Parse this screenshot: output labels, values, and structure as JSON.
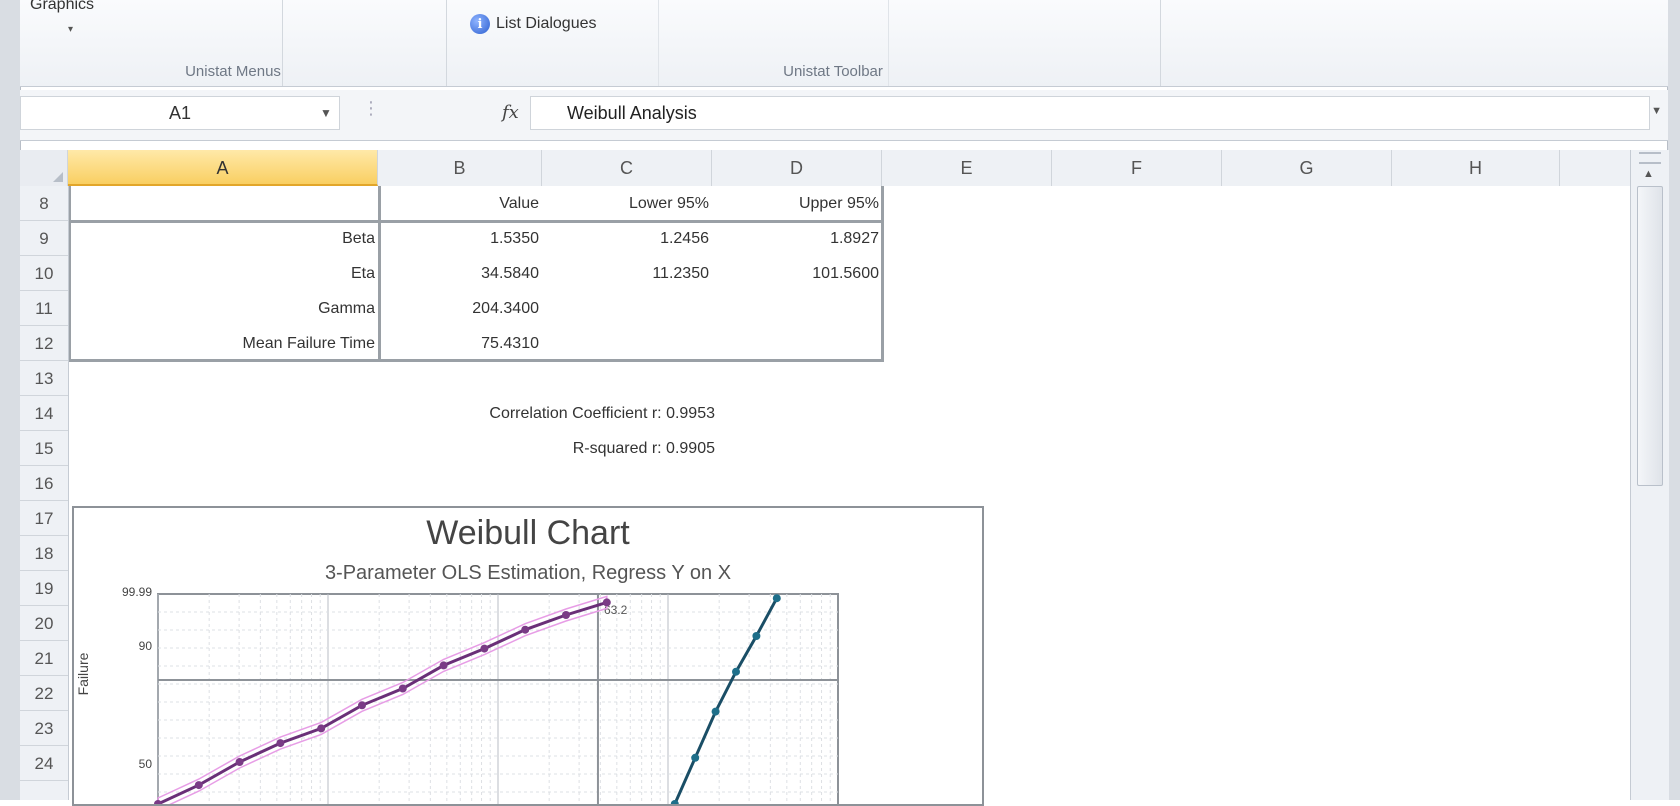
{
  "ribbon": {
    "graphics_label": "Graphics",
    "group_menus_label": "Unistat Menus",
    "list_dialogues_label": "List Dialogues",
    "group_toolbar_label": "Unistat Toolbar"
  },
  "formula_bar": {
    "name_box": "A1",
    "formula": "Weibull Analysis"
  },
  "columns": [
    "A",
    "B",
    "C",
    "D",
    "E",
    "F",
    "G",
    "H"
  ],
  "rows": [
    "8",
    "9",
    "10",
    "11",
    "12",
    "13",
    "14",
    "15",
    "16",
    "17",
    "18",
    "19",
    "20",
    "21",
    "22",
    "23",
    "24"
  ],
  "table": {
    "headers": {
      "value": "Value",
      "lower": "Lower 95%",
      "upper": "Upper 95%"
    },
    "rows": [
      {
        "label": "Beta",
        "value": "1.5350",
        "lower": "1.2456",
        "upper": "1.8927"
      },
      {
        "label": "Eta",
        "value": "34.5840",
        "lower": "11.2350",
        "upper": "101.5600"
      },
      {
        "label": "Gamma",
        "value": "204.3400",
        "lower": "",
        "upper": ""
      },
      {
        "label": "Mean Failure Time",
        "value": "75.4310",
        "lower": "",
        "upper": ""
      }
    ]
  },
  "stats": {
    "correlation": "Correlation Coefficient r: 0.9953",
    "rsquared": "R-squared r: 0.9905"
  },
  "chart": {
    "title": "Weibull Chart",
    "subtitle": "3-Parameter OLS Estimation, Regress Y on X",
    "y_ticks": [
      "99.99",
      "90",
      "50"
    ],
    "y_axis_label": "Failure",
    "marker_label": "63.2"
  },
  "chart_data": {
    "type": "scatter",
    "title": "Weibull Chart",
    "subtitle": "3-Parameter OLS Estimation, Regress Y on X",
    "ylabel": "Failure",
    "y_scale": "weibull probability",
    "grid": true,
    "series": [
      {
        "x": [
          0.0,
          0.06,
          0.12,
          0.18,
          0.24,
          0.3,
          0.36,
          0.42,
          0.48,
          0.54,
          0.6,
          0.66
        ],
        "y": [
          0.0,
          0.09,
          0.2,
          0.29,
          0.36,
          0.47,
          0.55,
          0.66,
          0.74,
          0.83,
          0.9,
          0.96
        ],
        "color": "#7a3b86"
      },
      {
        "x": [
          0.76,
          0.79,
          0.82,
          0.85,
          0.88,
          0.91
        ],
        "y": [
          0.0,
          0.22,
          0.44,
          0.63,
          0.8,
          0.98
        ],
        "color": "#1e6f8a"
      }
    ],
    "colors": {
      "confidence_band": "#e79de6",
      "fit_line_1": "#6a2f78",
      "fit_line_2": "#1a4e66"
    }
  }
}
